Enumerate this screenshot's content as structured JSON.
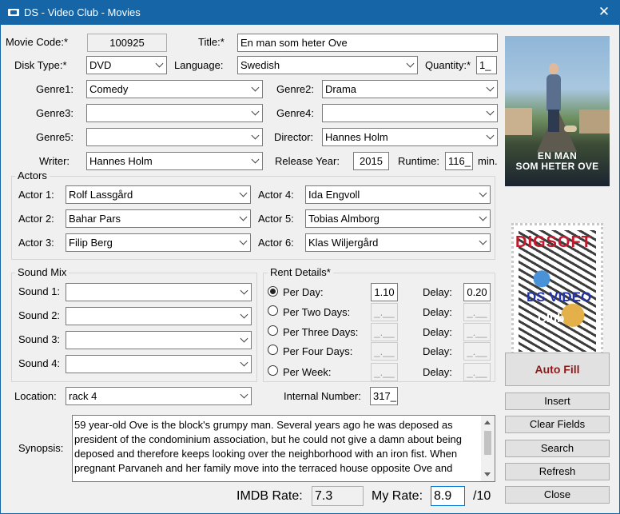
{
  "window": {
    "title": "DS - Video Club - Movies",
    "close_glyph": "✕"
  },
  "movie_code": {
    "label": "Movie Code:*",
    "value": "100925"
  },
  "title_field": {
    "label": "Title:*",
    "value": "En man som heter Ove"
  },
  "disk_type": {
    "label": "Disk Type:*",
    "value": "DVD"
  },
  "language": {
    "label": "Language:",
    "value": "Swedish"
  },
  "quantity": {
    "label": "Quantity:*",
    "value": "1_"
  },
  "genres": {
    "genre1": {
      "label": "Genre1:",
      "value": "Comedy"
    },
    "genre2": {
      "label": "Genre2:",
      "value": "Drama"
    },
    "genre3": {
      "label": "Genre3:",
      "value": ""
    },
    "genre4": {
      "label": "Genre4:",
      "value": ""
    },
    "genre5": {
      "label": "Genre5:",
      "value": ""
    }
  },
  "director": {
    "label": "Director:",
    "value": "Hannes Holm"
  },
  "writer": {
    "label": "Writer:",
    "value": "Hannes Holm"
  },
  "release_year": {
    "label": "Release Year:",
    "value": "2015"
  },
  "runtime": {
    "label": "Runtime:",
    "value": "116_",
    "unit": "min."
  },
  "actors": {
    "group_label": "Actors",
    "items": [
      {
        "label": "Actor 1:",
        "value": "Rolf Lassgård"
      },
      {
        "label": "Actor 2:",
        "value": "Bahar Pars"
      },
      {
        "label": "Actor 3:",
        "value": "Filip Berg"
      },
      {
        "label": "Actor 4:",
        "value": "Ida Engvoll"
      },
      {
        "label": "Actor 5:",
        "value": "Tobias Almborg"
      },
      {
        "label": "Actor 6:",
        "value": "Klas Wiljergård"
      }
    ]
  },
  "sound_mix": {
    "group_label": "Sound Mix",
    "items": [
      {
        "label": "Sound 1:",
        "value": ""
      },
      {
        "label": "Sound 2:",
        "value": ""
      },
      {
        "label": "Sound 3:",
        "value": ""
      },
      {
        "label": "Sound 4:",
        "value": ""
      }
    ]
  },
  "rent": {
    "group_label": "Rent Details*",
    "delay_label": "Delay:",
    "options": [
      {
        "label": "Per Day:",
        "price": "1.10",
        "delay": "0.20",
        "selected": true
      },
      {
        "label": "Per Two Days:",
        "price": "_.__",
        "delay": "_.__",
        "selected": false
      },
      {
        "label": "Per Three Days:",
        "price": "_.__",
        "delay": "_.__",
        "selected": false
      },
      {
        "label": "Per Four Days:",
        "price": "_.__",
        "delay": "_.__",
        "selected": false
      },
      {
        "label": "Per Week:",
        "price": "_.__",
        "delay": "_.__",
        "selected": false
      }
    ]
  },
  "location": {
    "label": "Location:",
    "value": "rack 4"
  },
  "internal_number": {
    "label": "Internal Number:",
    "value": "317_"
  },
  "synopsis": {
    "label": "Synopsis:",
    "value": "59 year-old Ove is the block's grumpy man. Several years ago he was deposed as president of the condominium association, but he could not give a damn about being deposed and therefore keeps looking over the neighborhood with an iron fist. When pregnant Parvaneh and her family move into the terraced house opposite Ove and"
  },
  "imdb_rate": {
    "label": "IMDB Rate:",
    "value": "7.3"
  },
  "my_rate": {
    "label": "My Rate:",
    "value": "8.9",
    "suffix": "/10"
  },
  "poster": {
    "title_line1": "EN MAN",
    "title_line2": "SOM HETER OVE"
  },
  "logo": {
    "text1": "DIGSOFT",
    "text2": "DS VIDEO",
    "text3": "Club"
  },
  "buttons": {
    "auto_fill": "Auto Fill",
    "insert": "Insert",
    "clear_fields": "Clear Fields",
    "search": "Search",
    "refresh": "Refresh",
    "close": "Close"
  },
  "colors": {
    "titlebar": "#1565a7",
    "accent_auto_fill": "#8b1a1a",
    "focus_border": "#0078d7"
  }
}
